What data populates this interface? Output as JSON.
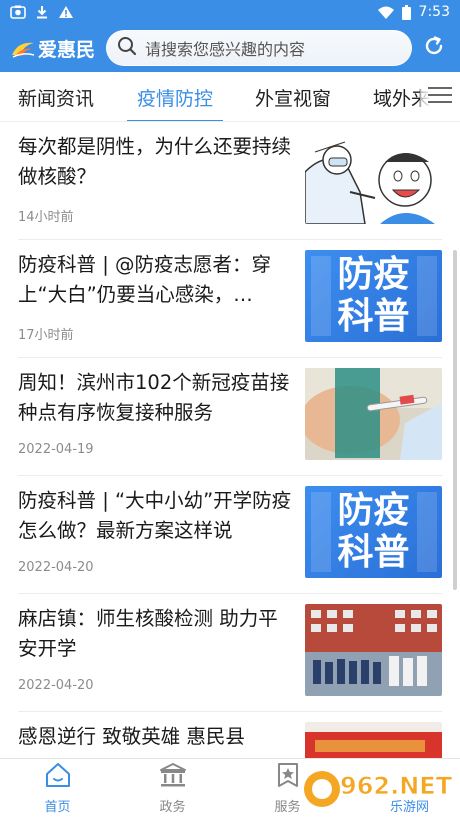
{
  "status_bar": {
    "time": "7:53",
    "icons": [
      "photo-icon",
      "download-icon",
      "warning-icon",
      "wifi-icon",
      "battery-icon"
    ]
  },
  "app": {
    "name": "爱惠民",
    "accent": "#3a8ee6"
  },
  "search": {
    "placeholder": "请搜索您感兴趣的内容"
  },
  "tabs": [
    {
      "label": "新闻资讯",
      "active": false
    },
    {
      "label": "疫情防控",
      "active": true
    },
    {
      "label": "外宣视窗",
      "active": false
    },
    {
      "label": "域外来",
      "active": false
    }
  ],
  "articles": [
    {
      "title": "每次都是阴性，为什么还要持续做核酸？",
      "time": "14小时前",
      "thumb": "nucleic-test-cartoon"
    },
    {
      "title": "防疫科普 | @防疫志愿者：穿上“大白”仍要当心感染，…",
      "time": "17小时前",
      "thumb": "fangyi-kepu-banner",
      "thumb_text": [
        "防疫",
        "科普"
      ]
    },
    {
      "title": "周知！滨州市102个新冠疫苗接种点有序恢复接种服务",
      "time": "2022-04-19",
      "thumb": "vaccine-injection-photo"
    },
    {
      "title": "防疫科普 | “大中小幼”开学防疫怎么做？最新方案这样说",
      "time": "2022-04-20",
      "thumb": "fangyi-kepu-banner",
      "thumb_text": [
        "防疫",
        "科普"
      ]
    },
    {
      "title": "麻店镇：师生核酸检测 助力平安开学",
      "time": "2022-04-20",
      "thumb": "school-testing-photo"
    },
    {
      "title": "感恩逆行 致敬英雄  惠民县",
      "time": "",
      "thumb": "red-banner-photo"
    }
  ],
  "bottom_nav": [
    {
      "label": "首页",
      "icon": "home-icon",
      "active": true
    },
    {
      "label": "政务",
      "icon": "government-icon",
      "active": false
    },
    {
      "label": "服务",
      "icon": "service-icon",
      "active": false
    }
  ],
  "watermark": {
    "brand": "962.NET",
    "sub": "乐游网"
  }
}
